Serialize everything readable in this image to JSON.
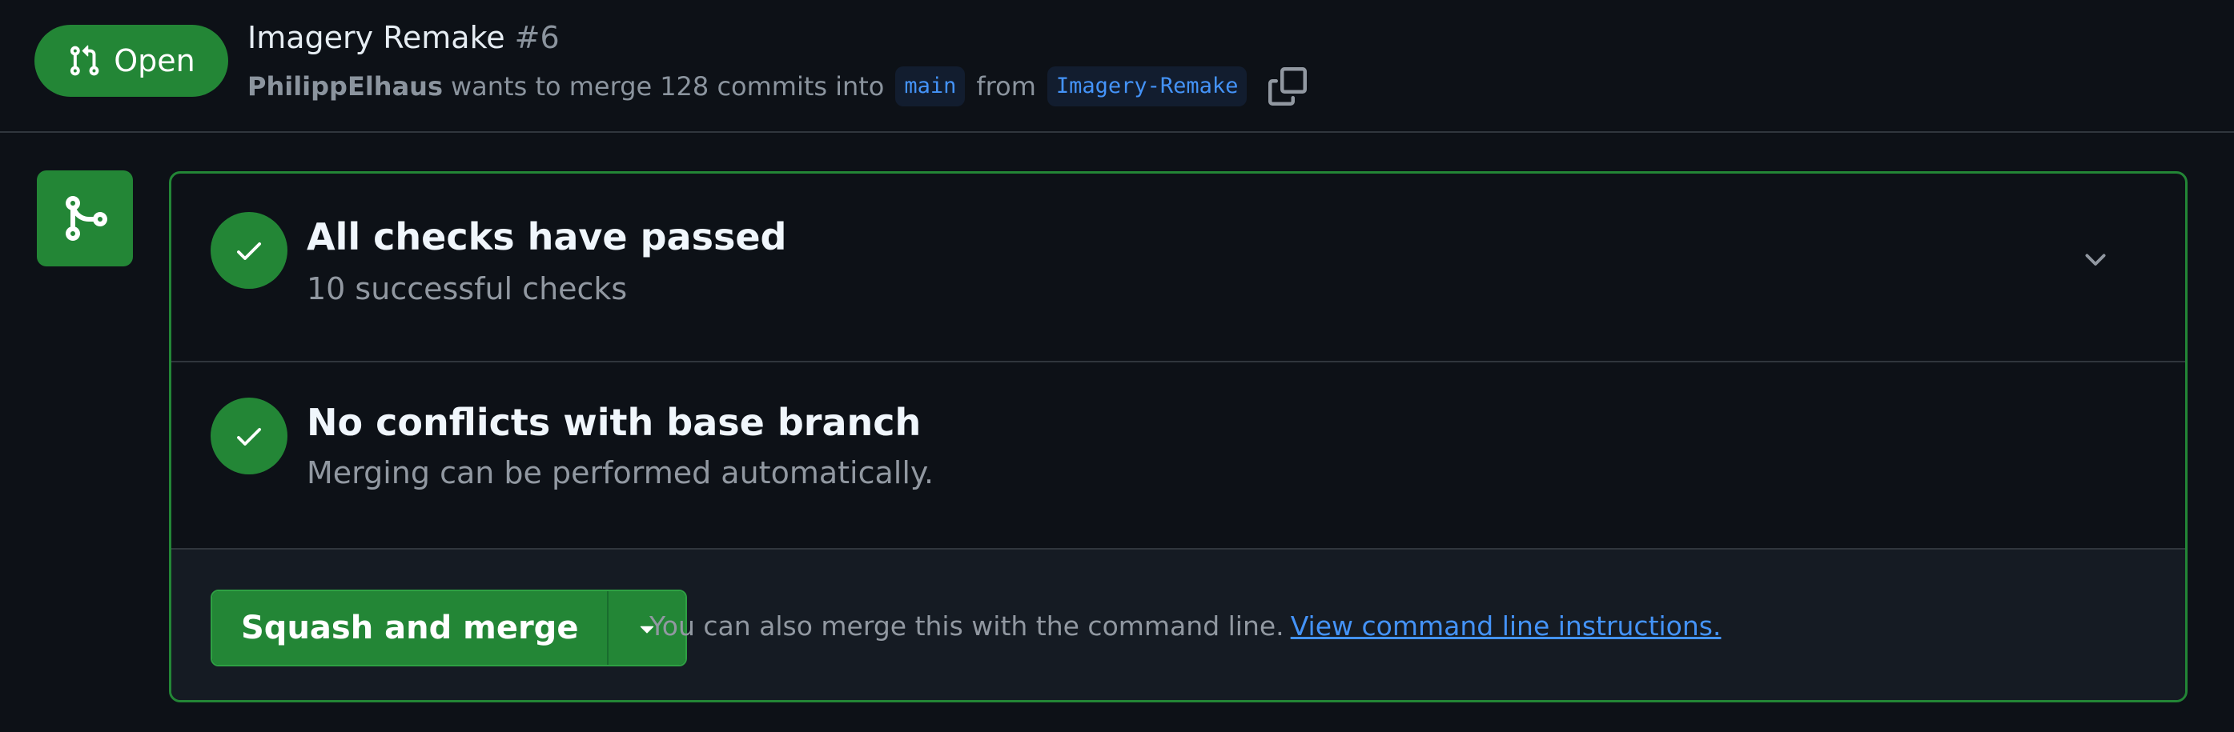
{
  "pr": {
    "state": "Open",
    "title": "Imagery Remake",
    "number": "#6",
    "author": "PhilippElhaus",
    "merge_text_1": "wants to merge",
    "commit_count": "128 commits",
    "merge_text_2": "into",
    "base_branch": "main",
    "merge_text_3": "from",
    "head_branch": "Imagery-Remake"
  },
  "icons": {
    "state": "git-pull-request-icon",
    "copy": "copy-icon",
    "merge_status": "git-merge-icon",
    "check": "check-icon",
    "expand": "chevron-down-icon",
    "dropdown": "triangle-down-icon"
  },
  "merge_box": {
    "checks": {
      "title": "All checks have passed",
      "subtitle": "10 successful checks"
    },
    "conflicts": {
      "title": "No conflicts with base branch",
      "subtitle": "Merging can be performed automatically."
    },
    "merge": {
      "button_label": "Squash and merge",
      "hint": "You can also merge this with the command line.",
      "link": "View command line instructions."
    }
  },
  "colors": {
    "background": "#0d1117",
    "success": "#238636",
    "link": "#4493f8",
    "muted": "#9198a1",
    "border": "#30363d"
  }
}
